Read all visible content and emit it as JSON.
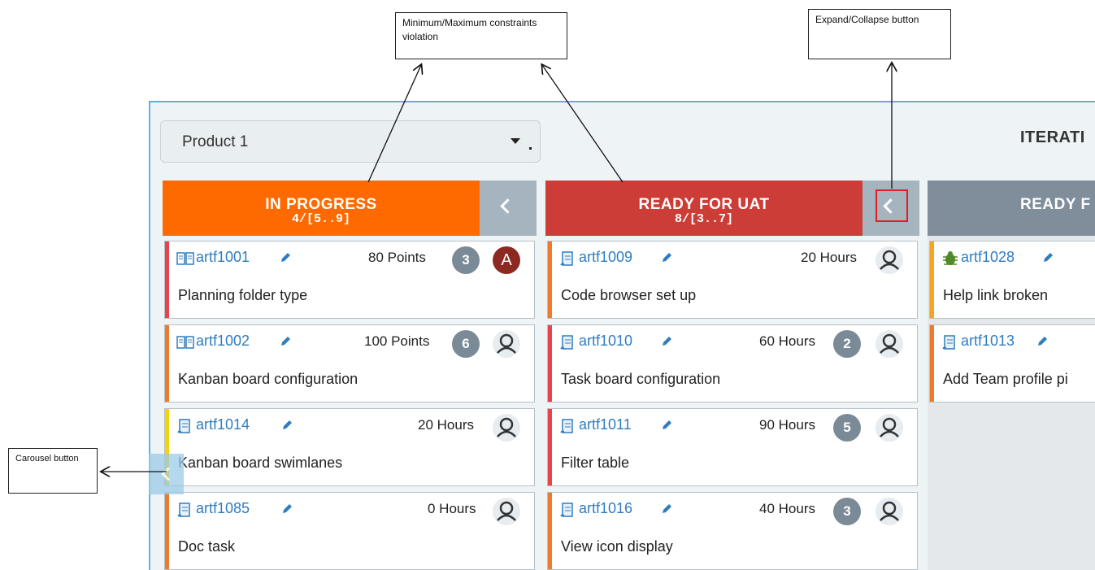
{
  "annotations": {
    "minmax": "Minimum/Maximum constraints violation",
    "expand_collapse": "Expand/Collapse button",
    "carousel": "Carousel button"
  },
  "product_selector": {
    "value": "Product 1"
  },
  "iteration_title": "ITERATI",
  "colors": {
    "in_progress": "#ff6a00",
    "ready_for_uat": "#cc3d37",
    "ready": "#7f8e9a",
    "link": "#2f7dbf",
    "frame_border": "#5ab2e0"
  },
  "columns": [
    {
      "name": "IN PROGRESS",
      "limits": "4/[5..9]",
      "cards": [
        {
          "id": "artf1001",
          "estimate": "80 Points",
          "badge": "3",
          "assignee_initial": "A",
          "title": "Planning folder type",
          "icon": "book-icon",
          "stripe": "#e8434a"
        },
        {
          "id": "artf1002",
          "estimate": "100 Points",
          "badge": "6",
          "title": "Kanban board configuration",
          "icon": "book-icon",
          "stripe": "#f07a2c"
        },
        {
          "id": "artf1014",
          "estimate": "20 Hours",
          "title": "Kanban board swimlanes",
          "icon": "task-icon",
          "stripe": "#f4d20a"
        },
        {
          "id": "artf1085",
          "estimate": "0 Hours",
          "title": "Doc task",
          "icon": "task-icon",
          "stripe": "#f07a2c"
        }
      ]
    },
    {
      "name": "READY FOR UAT",
      "limits": "8/[3..7]",
      "cards": [
        {
          "id": "artf1009",
          "estimate": "20 Hours",
          "title": "Code browser set up",
          "icon": "task-icon",
          "stripe": "#f07a2c"
        },
        {
          "id": "artf1010",
          "estimate": "60 Hours",
          "badge": "2",
          "title": "Task board configuration",
          "icon": "task-icon",
          "stripe": "#e8434a"
        },
        {
          "id": "artf1011",
          "estimate": "90 Hours",
          "badge": "5",
          "title": "Filter table",
          "icon": "task-icon",
          "stripe": "#e8434a"
        },
        {
          "id": "artf1016",
          "estimate": "40 Hours",
          "badge": "3",
          "title": "View icon display",
          "icon": "task-icon",
          "stripe": "#f07a2c"
        }
      ]
    },
    {
      "name": "READY F",
      "cards": [
        {
          "id": "artf1028",
          "title": "Help link broken",
          "icon": "bug-icon",
          "stripe": "#f5a623"
        },
        {
          "id": "artf1013",
          "title": "Add Team profile pi",
          "icon": "task-icon",
          "stripe": "#f07a2c"
        }
      ]
    }
  ]
}
